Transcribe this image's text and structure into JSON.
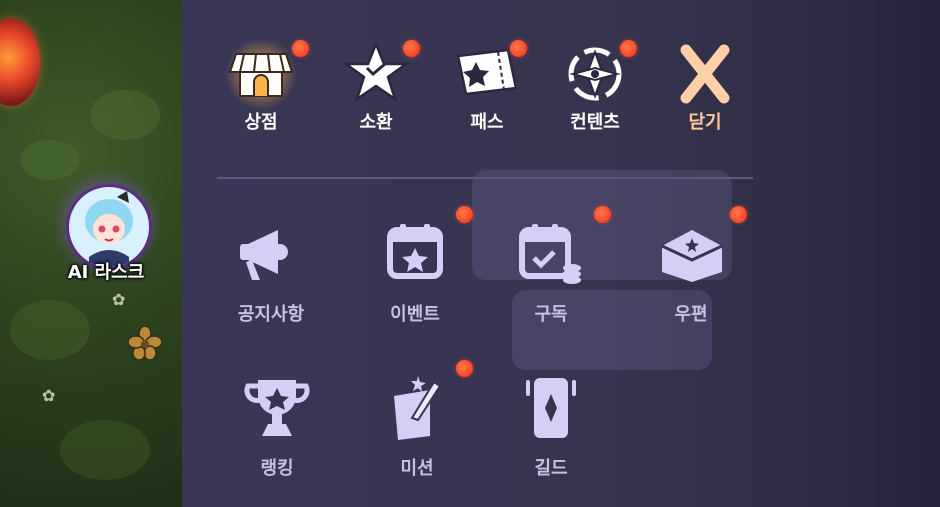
{
  "character": {
    "name": "AI 라스크"
  },
  "top_menu": [
    {
      "label": "상점",
      "icon": "shop-icon",
      "badge": true
    },
    {
      "label": "소환",
      "icon": "summon-star-icon",
      "badge": true
    },
    {
      "label": "패스",
      "icon": "pass-ticket-icon",
      "badge": true
    },
    {
      "label": "컨텐츠",
      "icon": "contents-compass-icon",
      "badge": true
    },
    {
      "label": "닫기",
      "icon": "close-icon",
      "badge": false
    }
  ],
  "grid_menu": [
    {
      "label": "공지사항",
      "icon": "megaphone-icon",
      "badge": false
    },
    {
      "label": "이벤트",
      "icon": "calendar-star-icon",
      "badge": true
    },
    {
      "label": "구독",
      "icon": "calendar-check-coins-icon",
      "badge": true
    },
    {
      "label": "우편",
      "icon": "mail-icon",
      "badge": true
    },
    {
      "label": "랭킹",
      "icon": "trophy-icon",
      "badge": false
    },
    {
      "label": "미션",
      "icon": "quill-scroll-icon",
      "badge": true
    },
    {
      "label": "길드",
      "icon": "guild-banner-icon",
      "badge": false
    }
  ],
  "colors": {
    "badge": "#ff4a2a",
    "icon_light": "#d6cff5",
    "close": "#ffc79a",
    "panel": "#37344f"
  }
}
